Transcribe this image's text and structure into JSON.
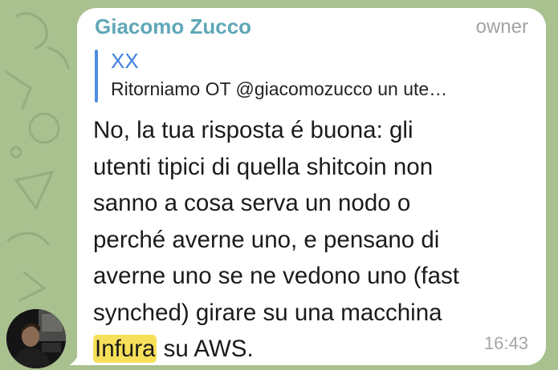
{
  "message": {
    "sender": "Giacomo Zucco",
    "role_badge": "owner",
    "reply": {
      "author": "XX",
      "preview": "Ritorniamo OT @giacomozucco un ute…"
    },
    "lines": [
      "No, la tua risposta é buona: gli",
      "utenti tipici di quella shitcoin non",
      "sanno a cosa serva un nodo o",
      "perché averne uno, e pensano di",
      "averne uno se ne vedono uno (fast",
      "synched) girare su una macchina"
    ],
    "last_line": {
      "highlight": "Infura",
      "rest": " su AWS."
    },
    "time": "16:43"
  },
  "colors": {
    "sender": "#5fa7b7",
    "reply_accent": "#4e8be6",
    "highlight": "#f6e05a",
    "wallpaper": "#a9c08f"
  }
}
